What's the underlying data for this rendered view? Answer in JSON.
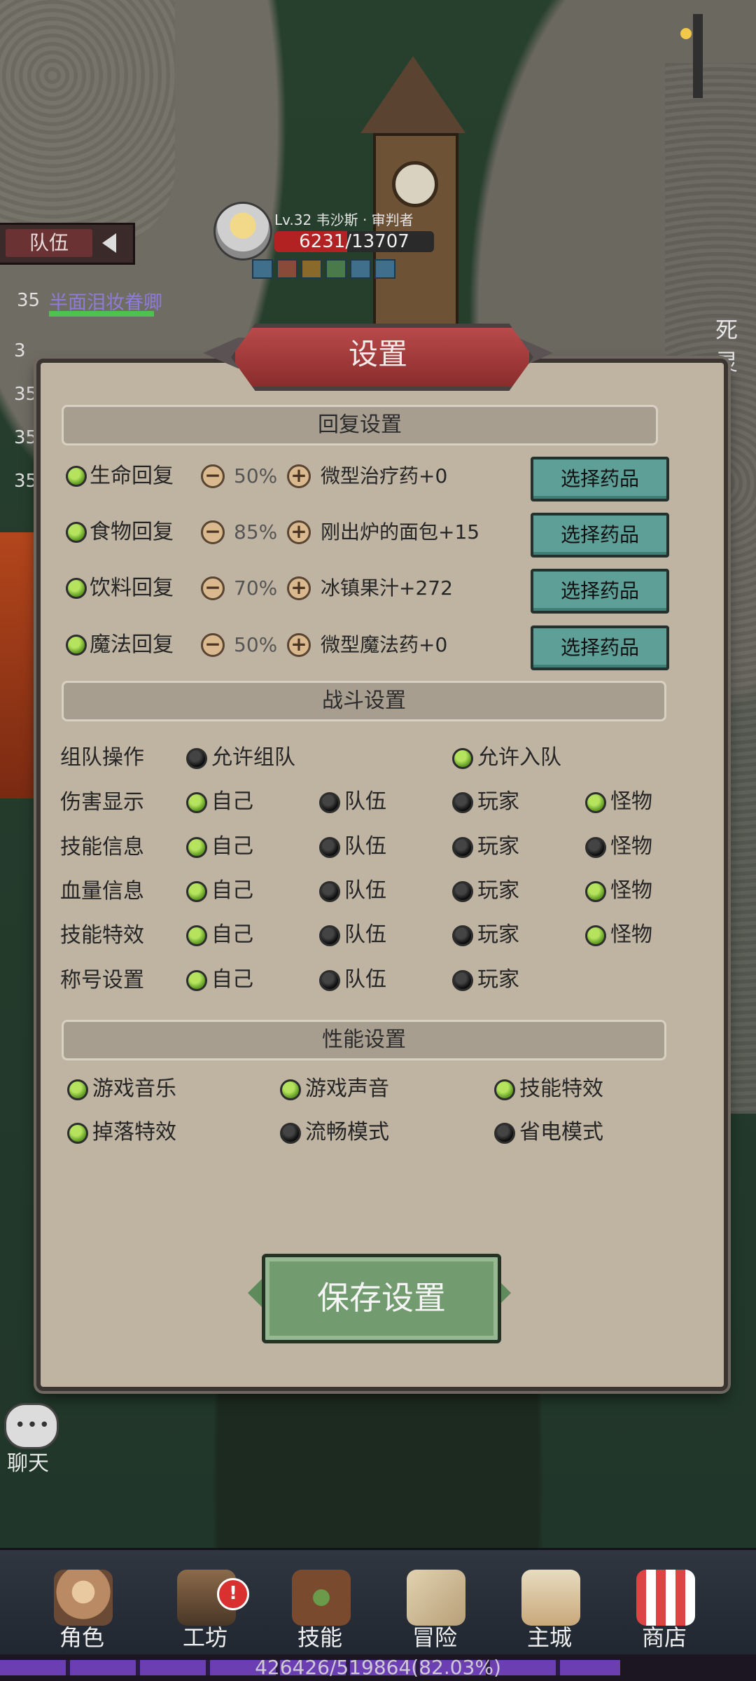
{
  "hud": {
    "player_name": "Lv.32 韦沙斯 · 审判者",
    "hp_text": "6231/13707",
    "hp_fraction": 0.455,
    "team_tab": "队伍",
    "team_member_level": "35",
    "team_member_name": "半面泪妆眷卿",
    "other_levels": [
      "3",
      "35",
      "35",
      "35"
    ],
    "right_name": "死灵"
  },
  "dialog": {
    "title": "设置",
    "recovery": {
      "header": "回复设置",
      "rows": [
        {
          "label": "生命回复",
          "percent": "50%",
          "item": "微型治疗药+0",
          "button": "选择药品",
          "on": true
        },
        {
          "label": "食物回复",
          "percent": "85%",
          "item": "刚出炉的面包+15",
          "button": "选择药品",
          "on": true
        },
        {
          "label": "饮料回复",
          "percent": "70%",
          "item": "冰镇果汁+272",
          "button": "选择药品",
          "on": true
        },
        {
          "label": "魔法回复",
          "percent": "50%",
          "item": "微型魔法药+0",
          "button": "选择药品",
          "on": true
        }
      ],
      "minus": "−",
      "plus": "+"
    },
    "combat": {
      "header": "战斗设置",
      "team_row": {
        "label": "组队操作",
        "opt1": "允许组队",
        "opt1_on": false,
        "opt2": "允许入队",
        "opt2_on": true
      },
      "rows": [
        {
          "label": "伤害显示",
          "self": true,
          "team": false,
          "player": false,
          "monster": true
        },
        {
          "label": "技能信息",
          "self": true,
          "team": false,
          "player": false,
          "monster": false
        },
        {
          "label": "血量信息",
          "self": true,
          "team": false,
          "player": false,
          "monster": true
        },
        {
          "label": "技能特效",
          "self": true,
          "team": false,
          "player": false,
          "monster": true
        },
        {
          "label": "称号设置",
          "self": true,
          "team": false,
          "player": false
        }
      ],
      "opt_self": "自己",
      "opt_team": "队伍",
      "opt_player": "玩家",
      "opt_monster": "怪物"
    },
    "performance": {
      "header": "性能设置",
      "items": [
        {
          "label": "游戏音乐",
          "on": true
        },
        {
          "label": "游戏声音",
          "on": true
        },
        {
          "label": "技能特效",
          "on": true
        },
        {
          "label": "掉落特效",
          "on": true
        },
        {
          "label": "流畅模式",
          "on": false
        },
        {
          "label": "省电模式",
          "on": false
        }
      ]
    },
    "save_button": "保存设置"
  },
  "chat": {
    "label": "聊天",
    "dots": "•••"
  },
  "bottom_nav": {
    "items": [
      {
        "label": "角色",
        "icon": "character-icon",
        "color": "#b98a64"
      },
      {
        "label": "工坊",
        "icon": "workshop-icon",
        "color": "#8a6a4a",
        "badge": "!"
      },
      {
        "label": "技能",
        "icon": "skill-book-icon",
        "color": "#7a4a2e"
      },
      {
        "label": "冒险",
        "icon": "adventure-map-icon",
        "color": "#c8b08a"
      },
      {
        "label": "主城",
        "icon": "castle-icon",
        "color": "#c9a87a"
      },
      {
        "label": "商店",
        "icon": "shop-icon",
        "color": "#c84a4a"
      }
    ]
  },
  "xp": {
    "text": "426426/519864(82.03%)",
    "fraction": 0.8203
  }
}
